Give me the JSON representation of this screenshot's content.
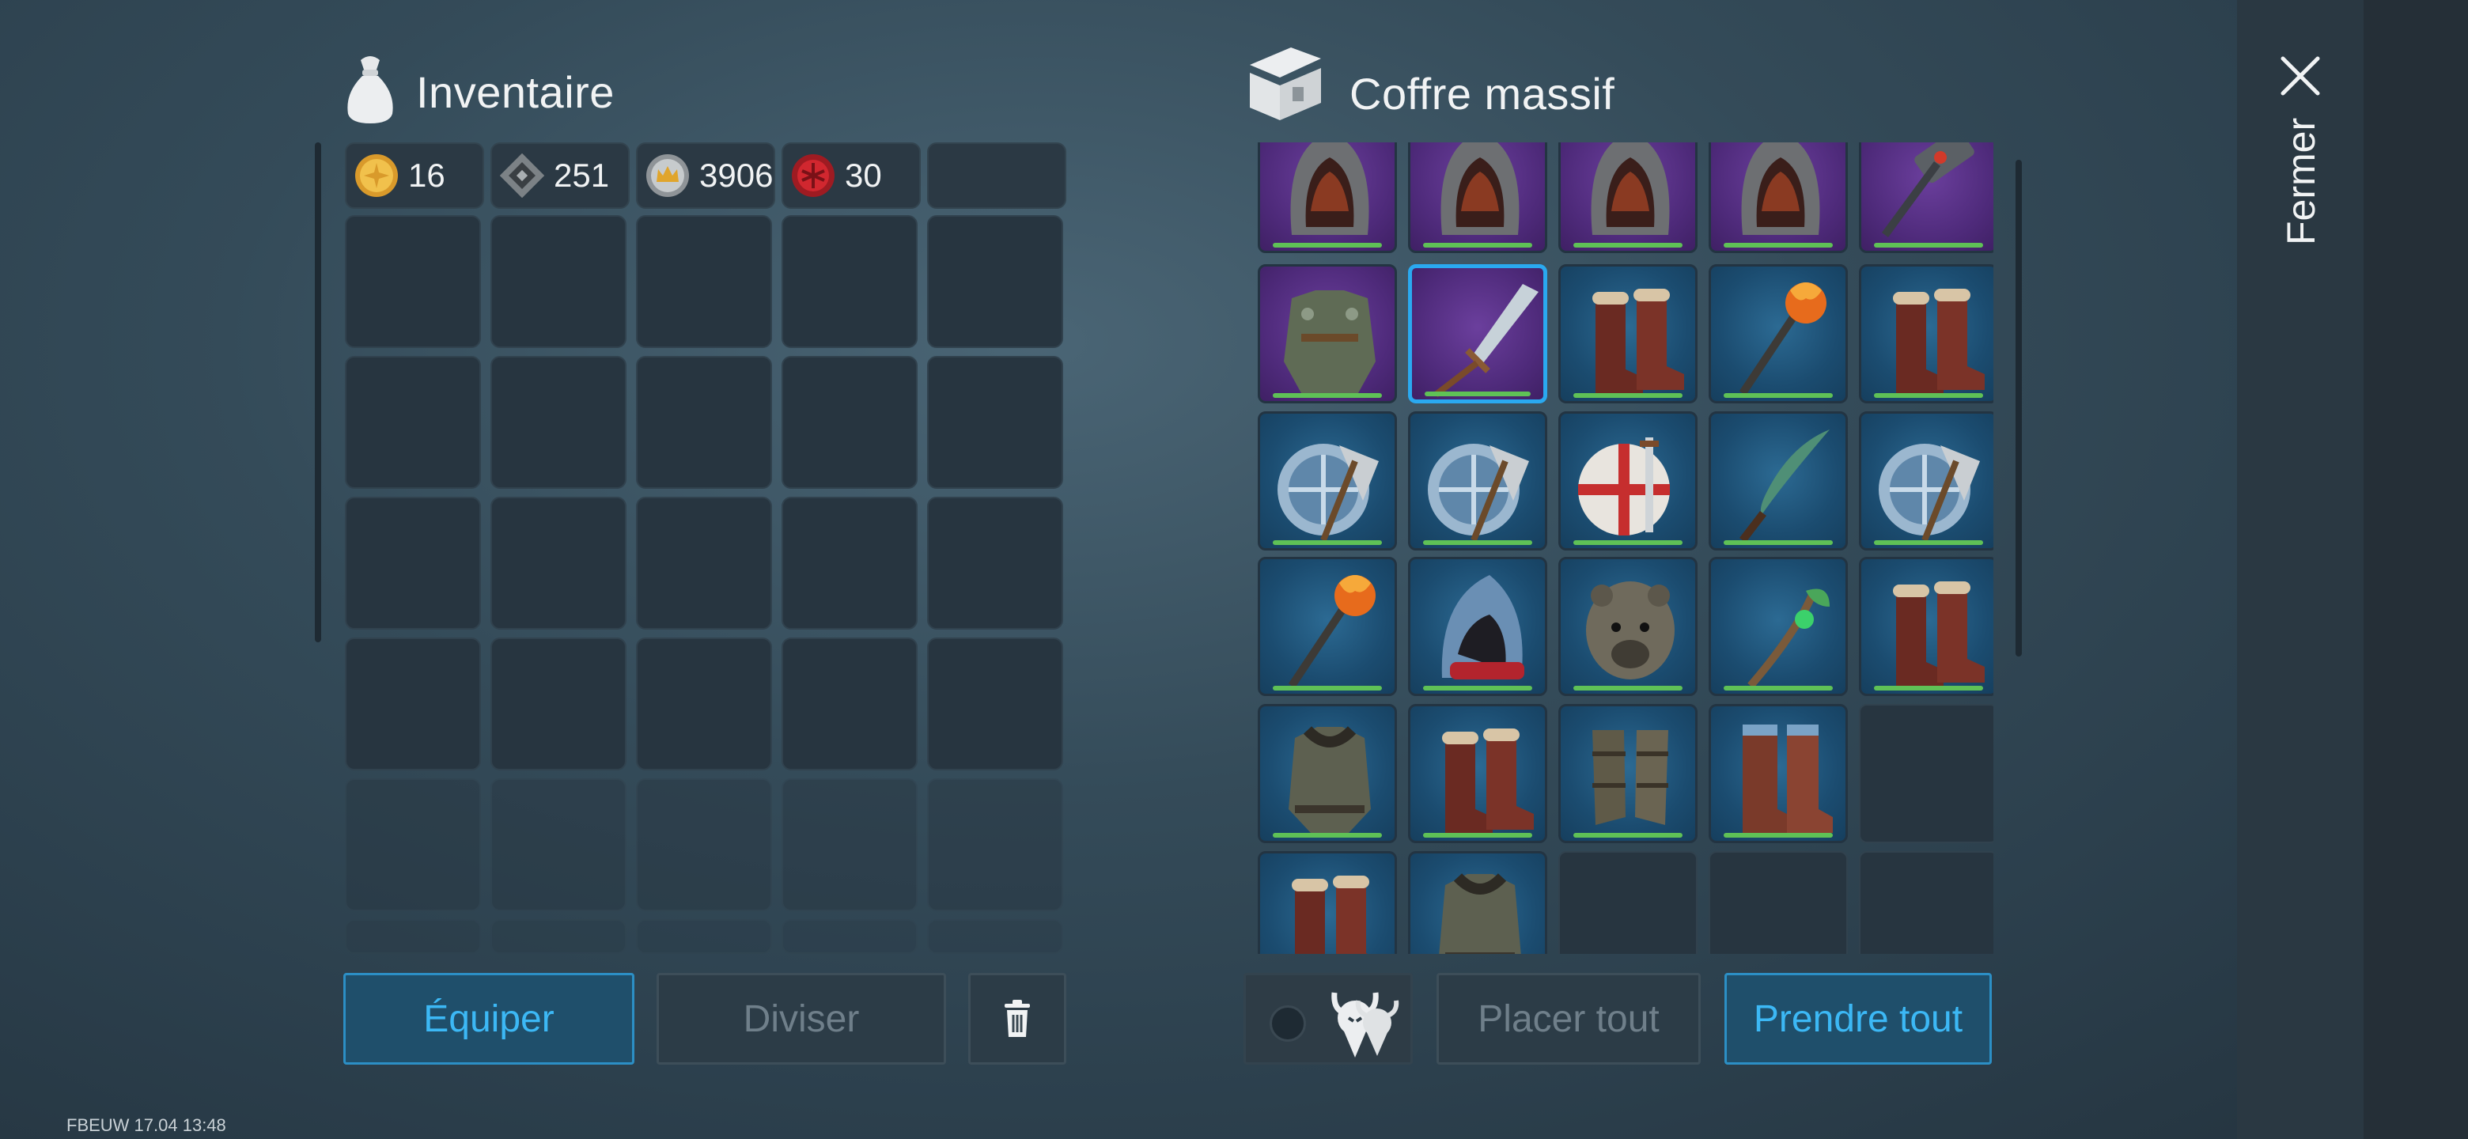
{
  "inventory": {
    "title": "Inventaire",
    "currencies": [
      {
        "icon": "gold-coin-icon",
        "amount": "16",
        "color": "#e2a83a"
      },
      {
        "icon": "iron-token-icon",
        "amount": "251",
        "color": "#8a8f93"
      },
      {
        "icon": "crown-coin-icon",
        "amount": "3906",
        "color": "#c9ccce"
      },
      {
        "icon": "red-seal-icon",
        "amount": "30",
        "color": "#c8242c"
      }
    ]
  },
  "chest": {
    "title": "Coffre massif",
    "items": [
      {
        "name": "hood-item",
        "rarity": "purple"
      },
      {
        "name": "hood-item",
        "rarity": "purple"
      },
      {
        "name": "hood-item",
        "rarity": "purple"
      },
      {
        "name": "hood-item",
        "rarity": "purple"
      },
      {
        "name": "war-hammer-item",
        "rarity": "purple"
      },
      {
        "name": "chainmail-armor-item",
        "rarity": "purple"
      },
      {
        "name": "crystal-sword-item",
        "rarity": "purple",
        "selected": true
      },
      {
        "name": "fur-boots-item",
        "rarity": "blue"
      },
      {
        "name": "fire-staff-item",
        "rarity": "blue"
      },
      {
        "name": "fur-boots-item",
        "rarity": "blue"
      },
      {
        "name": "round-shield-axe-item",
        "rarity": "blue"
      },
      {
        "name": "round-shield-axe-item",
        "rarity": "blue"
      },
      {
        "name": "striped-shield-sword-item",
        "rarity": "blue"
      },
      {
        "name": "curved-blade-item",
        "rarity": "blue"
      },
      {
        "name": "round-shield-axe-item",
        "rarity": "blue"
      },
      {
        "name": "fire-staff-item",
        "rarity": "blue"
      },
      {
        "name": "blue-hood-item",
        "rarity": "blue"
      },
      {
        "name": "bear-helm-item",
        "rarity": "blue"
      },
      {
        "name": "nature-staff-item",
        "rarity": "blue"
      },
      {
        "name": "fur-boots-item",
        "rarity": "blue"
      },
      {
        "name": "fur-armor-item",
        "rarity": "blue"
      },
      {
        "name": "fur-boots-item",
        "rarity": "blue"
      },
      {
        "name": "leather-greaves-item",
        "rarity": "blue"
      },
      {
        "name": "strapped-boots-item",
        "rarity": "blue"
      },
      {
        "name": "empty-slot",
        "rarity": "empty"
      },
      {
        "name": "fur-boots-item",
        "rarity": "blue"
      },
      {
        "name": "fur-armor-item",
        "rarity": "blue"
      },
      {
        "name": "empty-slot",
        "rarity": "empty"
      },
      {
        "name": "empty-slot",
        "rarity": "empty"
      },
      {
        "name": "empty-slot",
        "rarity": "empty"
      }
    ]
  },
  "buttons": {
    "equip": "Équiper",
    "split": "Diviser",
    "place_all": "Placer tout",
    "take_all": "Prendre tout"
  },
  "close": {
    "label": "Fermer"
  },
  "footer": {
    "build": "FBEUW 17.04 13:48"
  },
  "colors": {
    "accent": "#3cb8f5",
    "rarity_blue": "#1b4c70",
    "rarity_purple": "#4e2a7a",
    "durability": "#5fc156"
  }
}
